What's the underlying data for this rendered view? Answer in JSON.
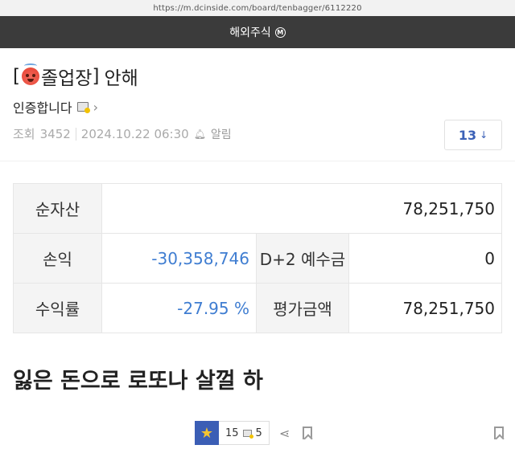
{
  "browser": {
    "url": "https://m.dcinside.com/board/tenbagger/6112220"
  },
  "header": {
    "gallery_name": "해외주식",
    "badge": "M"
  },
  "post": {
    "title_open": "[",
    "title_tag": "졸업장",
    "title_close": "]",
    "title_text": "안해",
    "author": "인증합니다",
    "views_label": "조회",
    "views": "3452",
    "datetime": "2024.10.22 06:30",
    "alarm_label": "알림",
    "comment_count": "13",
    "body": "잃은 돈으로 로또나 살껄 하"
  },
  "table": {
    "rows": [
      {
        "label1": "순자산",
        "value1": "78,251,750"
      },
      {
        "label1": "손익",
        "value1": "-30,358,746",
        "label2": "D+2 예수금",
        "value2": "0"
      },
      {
        "label1": "수익률",
        "value1": "-27.95 %",
        "label2": "평가금액",
        "value2": "78,251,750"
      }
    ]
  },
  "actions": {
    "recommend_count": "15",
    "fix_count": "5"
  },
  "colors": {
    "header_bg": "#3b3b3b",
    "accent_blue": "#3b61b7",
    "negative": "#3f7dd1",
    "star": "#f4c430"
  }
}
